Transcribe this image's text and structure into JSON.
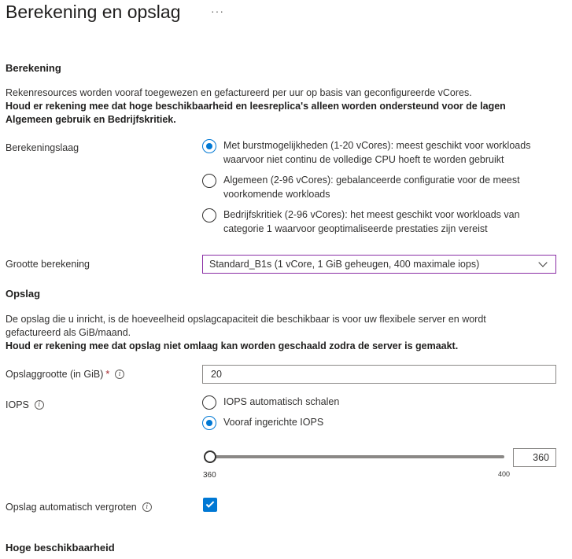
{
  "page": {
    "title": "Berekening en opslag",
    "more": "···"
  },
  "compute": {
    "heading": "Berekening",
    "description": "Rekenresources worden vooraf toegewezen en gefactureerd per uur op basis van geconfigureerde vCores.",
    "note": "Houd er rekening mee dat hoge beschikbaarheid en leesreplica's alleen worden ondersteund voor de lagen Algemeen gebruik en Bedrijfskritiek.",
    "tier_label": "Berekeningslaag",
    "tiers": [
      {
        "line1": "Met burstmogelijkheden (1-20 vCores): meest geschikt voor workloads",
        "line2": "waarvoor niet continu de volledige CPU hoeft te worden gebruikt",
        "selected": true
      },
      {
        "line1": "Algemeen (2-96 vCores): gebalanceerde configuratie voor de meest",
        "line2": "voorkomende workloads",
        "selected": false
      },
      {
        "line1": "Bedrijfskritiek (2-96 vCores): het meest geschikt voor workloads van",
        "line2": "categorie 1 waarvoor geoptimaliseerde prestaties zijn vereist",
        "selected": false
      }
    ],
    "size_label": "Grootte berekening",
    "size_value": "Standard_B1s (1 vCore, 1 GiB geheugen, 400 maximale iops)"
  },
  "storage": {
    "heading": "Opslag",
    "description": "De opslag die u inricht, is de hoeveelheid opslagcapaciteit die beschikbaar is voor uw flexibele server en wordt gefactureerd als GiB/maand.",
    "note": "Houd er rekening mee dat opslag niet omlaag kan worden geschaald zodra de server is gemaakt.",
    "size_label": "Opslaggrootte (in GiB)",
    "required_mark": "*",
    "size_value": "20",
    "iops_label": "IOPS",
    "iops_options": [
      {
        "label": "IOPS automatisch schalen",
        "selected": false
      },
      {
        "label": "Vooraf ingerichte IOPS",
        "selected": true
      }
    ],
    "iops_value": "360",
    "iops_min": "360",
    "iops_max": "400",
    "autogrow_label": "Opslag automatisch vergroten",
    "autogrow_checked": true
  },
  "ha": {
    "heading": "Hoge beschikbaarheid"
  },
  "icons": {
    "info": "i"
  }
}
